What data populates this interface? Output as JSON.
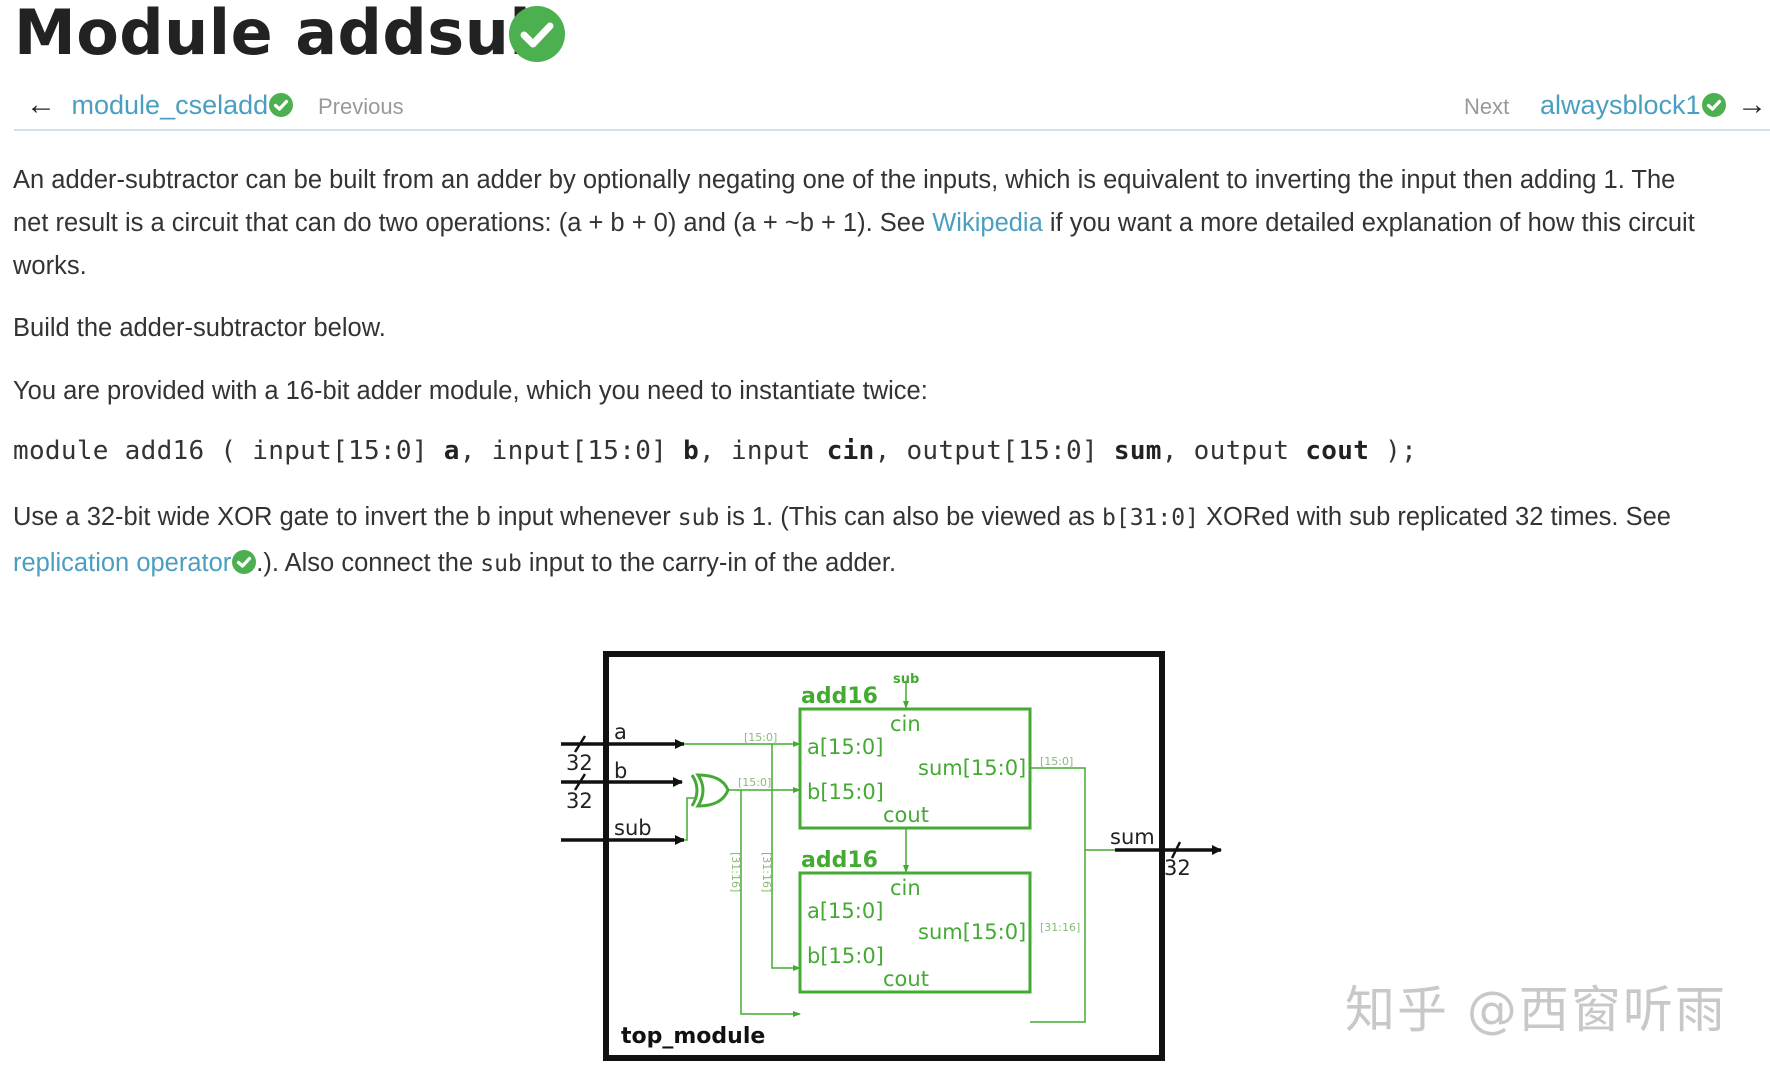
{
  "header": {
    "title": "Module addsub",
    "solved_icon": "check-circle-icon",
    "accent_green": "#4caf50",
    "link_color": "#4a9fc0"
  },
  "nav": {
    "prev_arrow": "←",
    "prev_link": "module_cseladd",
    "prev_label": "Previous",
    "next_label": "Next",
    "next_link": "alwaysblock1",
    "next_arrow": "→"
  },
  "content": {
    "p1_line1": "An adder-subtractor can be built from an adder by optionally negating one of the inputs, which is equivalent to inverting the input then adding 1. The",
    "p1_line2_a": "net result is a circuit that can do two operations: (a + b + 0) and (a + ~b + 1). See ",
    "p1_link": "Wikipedia",
    "p1_line2_b": " if you want a more detailed explanation of how this circuit",
    "p1_line3": "works.",
    "p2": "Build the adder-subtractor below.",
    "p3": "You are provided with a 16-bit adder module, which you need to instantiate twice:",
    "code": {
      "t1": "module add16 ( input[15:0] ",
      "b1": "a",
      "t2": ", input[15:0] ",
      "b2": "b",
      "t3": ", input ",
      "b3": "cin",
      "t4": ", output[15:0] ",
      "b4": "sum",
      "t5": ", output ",
      "b5": "cout",
      "t6": " );"
    },
    "p4_line1_a": "Use a 32-bit wide XOR gate to invert the b input whenever ",
    "p4_sub1": "sub",
    "p4_line1_b": " is 1. (This can also be viewed as ",
    "p4_mono": "b[31:0]",
    "p4_line1_c": " XORed with sub replicated 32 times. See",
    "p4_link": "replication operator",
    "p4_line2_a": ".). Also connect the ",
    "p4_sub2": "sub",
    "p4_line2_b": " input to the carry-in of the adder."
  },
  "diagram": {
    "module_label": "top_module",
    "inputs": [
      "a",
      "b",
      "sub"
    ],
    "bus_width": "32",
    "output": "sum",
    "adder_name": "add16",
    "port_cin": "cin",
    "port_a": "a[15:0]",
    "port_b": "b[15:0]",
    "port_sum": "sum[15:0]",
    "port_cout": "cout",
    "sub_label": "sub",
    "slice_low": "[15:0]",
    "slice_high": "[31:16]",
    "wire_color": "#44aa33",
    "stroke_color": "#111111"
  },
  "watermark": "知乎 @西窗听雨"
}
